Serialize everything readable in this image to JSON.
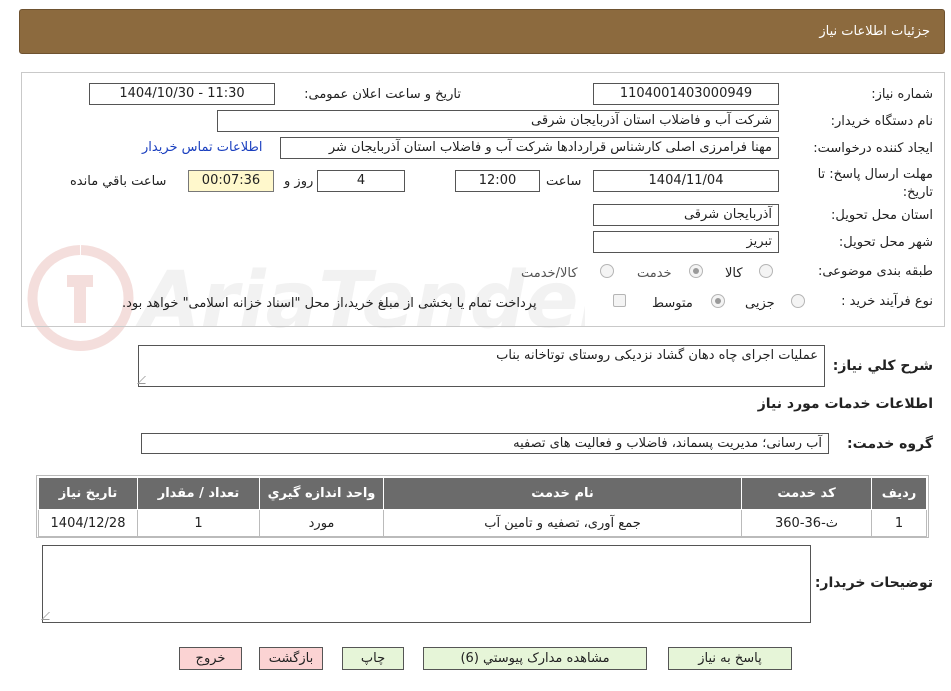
{
  "header": {
    "title": "جزئیات اطلاعات نیاز"
  },
  "form": {
    "need_number_label": "شماره نیاز:",
    "need_number": "1104001403000949",
    "announce_label": "تاریخ و ساعت اعلان عمومی:",
    "announce_value": "1404/10/30 - 11:30",
    "buyer_org_label": "نام دستگاه خریدار:",
    "buyer_org": "شرکت آب و فاضلاب استان آذربایجان شرقی",
    "requester_label": "ایجاد کننده درخواست:",
    "requester": "مهنا فرامرزی اصلی کارشناس قراردادها شرکت آب و فاضلاب استان آذربایجان شر",
    "contact_link": "اطلاعات تماس خریدار",
    "deadline_label": "مهلت ارسال پاسخ: تا تاریخ:",
    "deadline_date": "1404/11/04",
    "time_label": "ساعت",
    "deadline_time": "12:00",
    "days_value": "4",
    "days_label": "روز و",
    "remaining_time": "00:07:36",
    "remaining_label": "ساعت باقي مانده",
    "province_label": "استان محل تحویل:",
    "province": "آذربایجان شرقی",
    "city_label": "شهر محل تحویل:",
    "city": "تبریز",
    "category_label": "طبقه بندی موضوعی:",
    "category_options": [
      "کالا",
      "خدمت",
      "کالا/خدمت"
    ],
    "process_label": "نوع فرآیند خرید :",
    "process_options": [
      "جزیی",
      "متوسط"
    ],
    "payment_note": "پرداخت تمام یا بخشی از مبلغ خرید،از محل \"اسناد خزانه اسلامی\" خواهد بود."
  },
  "watermark_text": "AriaTender.neT",
  "summary": {
    "label": "شرح کلي نياز:",
    "text": "عملیات اجرای چاه دهان گشاد نزدیکی روستای توتاخانه بناب"
  },
  "services_section": {
    "title": "اطلاعات خدمات مورد نياز",
    "group_label": "گروه خدمت:",
    "group_value": "آب رسانی؛ مدیریت پسماند، فاضلاب و فعالیت های تصفیه"
  },
  "table": {
    "headers": [
      "رديف",
      "کد خدمت",
      "نام خدمت",
      "واحد اندازه گيري",
      "تعداد / مقدار",
      "تاريخ نياز"
    ],
    "rows": [
      [
        "1",
        "ث-36-360",
        "جمع آوری، تصفیه و تامین آب",
        "مورد",
        "1",
        "1404/12/28"
      ]
    ]
  },
  "buyer_notes": {
    "label": "توضیحات خریدار:",
    "text": ""
  },
  "buttons": {
    "reply": "پاسخ به نیاز",
    "attachments": "مشاهده مدارک پیوستي (6)",
    "print": "چاپ",
    "back": "بازگشت",
    "exit": "خروج"
  },
  "colors": {
    "header_bg": "#8c6a3e",
    "table_header_bg": "#6b6b6b",
    "button_green": "#e6f5d8",
    "button_red": "#fbd3d3",
    "link": "#1a3fbf"
  }
}
